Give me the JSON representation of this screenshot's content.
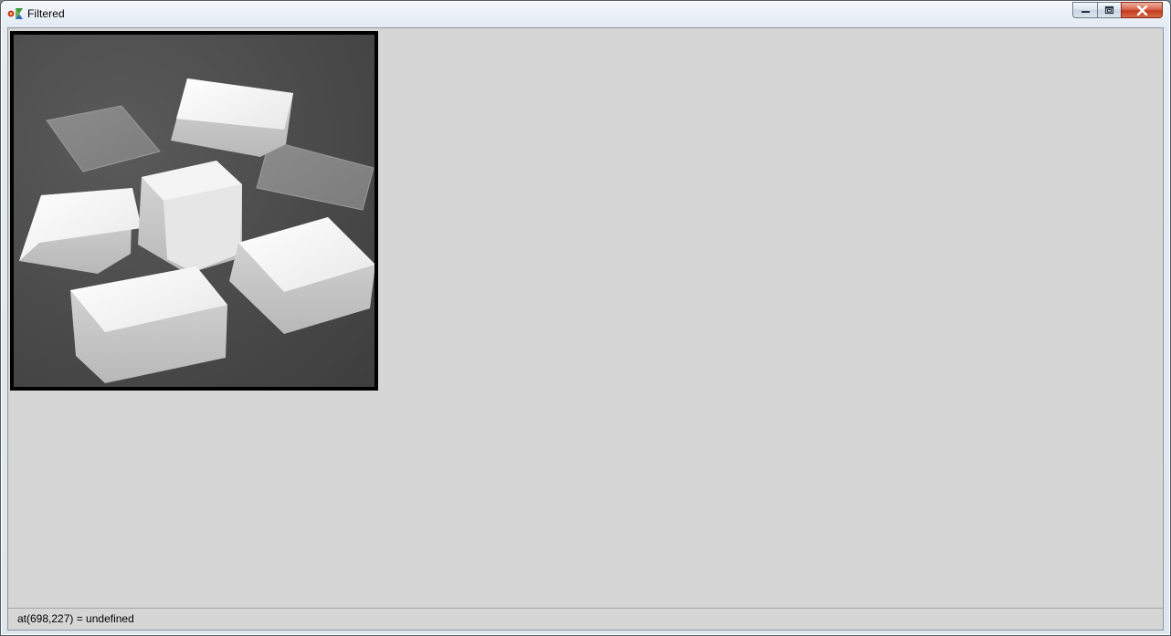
{
  "window": {
    "title": "Filtered",
    "app_icon": "gtk-logo-icon"
  },
  "caption": {
    "minimize_icon": "minimize-icon",
    "maximize_icon": "restore-icon",
    "close_icon": "close-icon"
  },
  "image": {
    "subject": "grayscale-photo-white-blocks-filtered"
  },
  "status": {
    "text": "at(698,227) = undefined"
  },
  "colors": {
    "client_background": "#d6d6d6",
    "image_border": "#000000",
    "close_button": "#c43b1e"
  }
}
